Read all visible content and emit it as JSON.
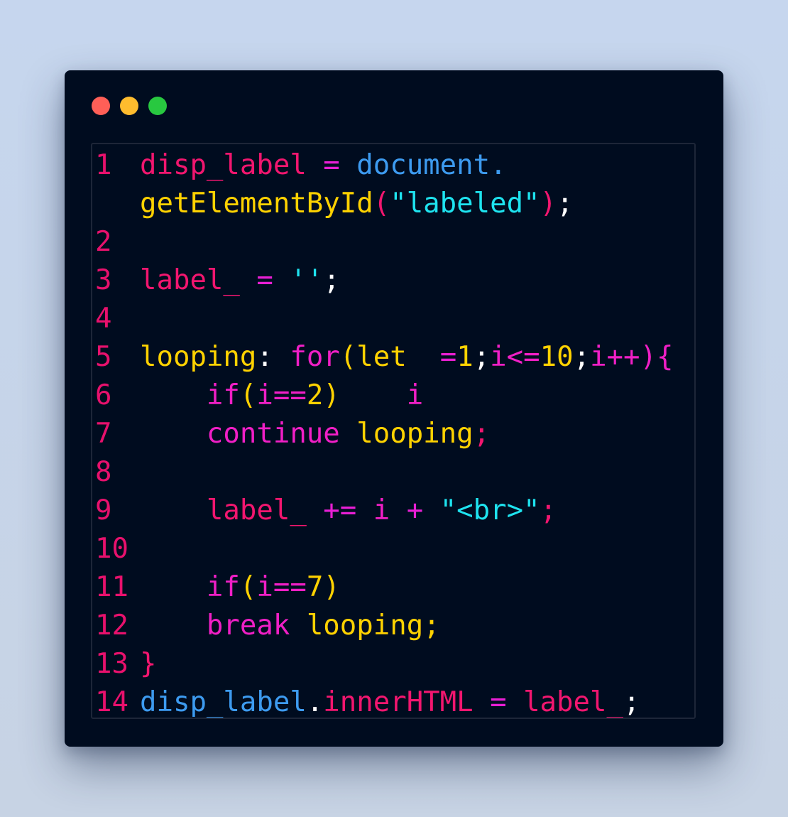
{
  "window": {
    "traffic_lights": [
      {
        "name": "close",
        "color": "#ff5f57"
      },
      {
        "name": "minimize",
        "color": "#febc2e"
      },
      {
        "name": "zoom",
        "color": "#28c840"
      }
    ]
  },
  "colors": {
    "background": "#000c1f",
    "line_number": "#e8116d",
    "identifier": "#f2166f",
    "keyword": "#f01fc6",
    "operator": "#e81fd4",
    "function": "#ffd200",
    "property": "#3d9bf0",
    "string": "#1ee3ef",
    "punctuation": "#ffffff"
  },
  "editor": {
    "lines": [
      {
        "number": "1",
        "tokens": [
          {
            "text": "disp_label",
            "kind": "identifier"
          },
          {
            "text": " ",
            "kind": "punctuation"
          },
          {
            "text": "=",
            "kind": "operator"
          },
          {
            "text": " ",
            "kind": "punctuation"
          },
          {
            "text": "document",
            "kind": "property"
          },
          {
            "text": ".",
            "kind": "property"
          }
        ]
      },
      {
        "number": "",
        "tokens": [
          {
            "text": "getElementById",
            "kind": "function"
          },
          {
            "text": "(",
            "kind": "identifier"
          },
          {
            "text": "\"labeled\"",
            "kind": "string"
          },
          {
            "text": ")",
            "kind": "identifier"
          },
          {
            "text": ";",
            "kind": "punctuation"
          }
        ]
      },
      {
        "number": "2",
        "tokens": []
      },
      {
        "number": "3",
        "tokens": [
          {
            "text": "label_",
            "kind": "identifier"
          },
          {
            "text": " ",
            "kind": "punctuation"
          },
          {
            "text": "=",
            "kind": "operator"
          },
          {
            "text": " ",
            "kind": "punctuation"
          },
          {
            "text": "''",
            "kind": "string"
          },
          {
            "text": ";",
            "kind": "punctuation"
          }
        ]
      },
      {
        "number": "4",
        "tokens": []
      },
      {
        "number": "5",
        "tokens": [
          {
            "text": "looping",
            "kind": "function"
          },
          {
            "text": ": ",
            "kind": "punctuation"
          },
          {
            "text": "for",
            "kind": "keyword"
          },
          {
            "text": "(",
            "kind": "function"
          },
          {
            "text": "let",
            "kind": "function"
          },
          {
            "text": "  ",
            "kind": "punctuation"
          },
          {
            "text": "=",
            "kind": "operator"
          },
          {
            "text": "1",
            "kind": "function"
          },
          {
            "text": ";",
            "kind": "punctuation"
          },
          {
            "text": "i<=",
            "kind": "keyword"
          },
          {
            "text": "10",
            "kind": "function"
          },
          {
            "text": ";",
            "kind": "punctuation"
          },
          {
            "text": "i++){",
            "kind": "keyword"
          }
        ]
      },
      {
        "number": "6",
        "tokens": [
          {
            "text": "    ",
            "kind": "punctuation"
          },
          {
            "text": "if",
            "kind": "keyword"
          },
          {
            "text": "(",
            "kind": "function"
          },
          {
            "text": "i==",
            "kind": "keyword"
          },
          {
            "text": "2",
            "kind": "function"
          },
          {
            "text": ")",
            "kind": "function"
          },
          {
            "text": "    ",
            "kind": "punctuation"
          },
          {
            "text": "i",
            "kind": "keyword"
          }
        ]
      },
      {
        "number": "7",
        "tokens": [
          {
            "text": "    ",
            "kind": "punctuation"
          },
          {
            "text": "continue",
            "kind": "keyword"
          },
          {
            "text": " ",
            "kind": "punctuation"
          },
          {
            "text": "looping",
            "kind": "function"
          },
          {
            "text": ";",
            "kind": "identifier"
          }
        ]
      },
      {
        "number": "8",
        "tokens": []
      },
      {
        "number": "9",
        "tokens": [
          {
            "text": "    ",
            "kind": "punctuation"
          },
          {
            "text": "label_",
            "kind": "identifier"
          },
          {
            "text": " ",
            "kind": "punctuation"
          },
          {
            "text": "+=",
            "kind": "operator"
          },
          {
            "text": " ",
            "kind": "punctuation"
          },
          {
            "text": "i",
            "kind": "keyword"
          },
          {
            "text": " ",
            "kind": "punctuation"
          },
          {
            "text": "+",
            "kind": "operator"
          },
          {
            "text": " ",
            "kind": "punctuation"
          },
          {
            "text": "\"<br>\"",
            "kind": "string"
          },
          {
            "text": ";",
            "kind": "identifier"
          }
        ]
      },
      {
        "number": "10",
        "tokens": []
      },
      {
        "number": "11",
        "tokens": [
          {
            "text": "    ",
            "kind": "punctuation"
          },
          {
            "text": "if",
            "kind": "keyword"
          },
          {
            "text": "(",
            "kind": "function"
          },
          {
            "text": "i==",
            "kind": "keyword"
          },
          {
            "text": "7",
            "kind": "function"
          },
          {
            "text": ")",
            "kind": "function"
          }
        ]
      },
      {
        "number": "12",
        "tokens": [
          {
            "text": "    ",
            "kind": "punctuation"
          },
          {
            "text": "break",
            "kind": "keyword"
          },
          {
            "text": " ",
            "kind": "punctuation"
          },
          {
            "text": "looping",
            "kind": "function"
          },
          {
            "text": ";",
            "kind": "function"
          }
        ]
      },
      {
        "number": "13",
        "tokens": [
          {
            "text": "}",
            "kind": "identifier"
          }
        ]
      },
      {
        "number": "14",
        "tokens": [
          {
            "text": "disp_label",
            "kind": "property"
          },
          {
            "text": ".",
            "kind": "punctuation"
          },
          {
            "text": "innerHTML",
            "kind": "identifier"
          },
          {
            "text": " ",
            "kind": "punctuation"
          },
          {
            "text": "=",
            "kind": "operator"
          },
          {
            "text": " ",
            "kind": "punctuation"
          },
          {
            "text": "label_",
            "kind": "identifier"
          },
          {
            "text": ";",
            "kind": "punctuation"
          }
        ]
      }
    ]
  }
}
